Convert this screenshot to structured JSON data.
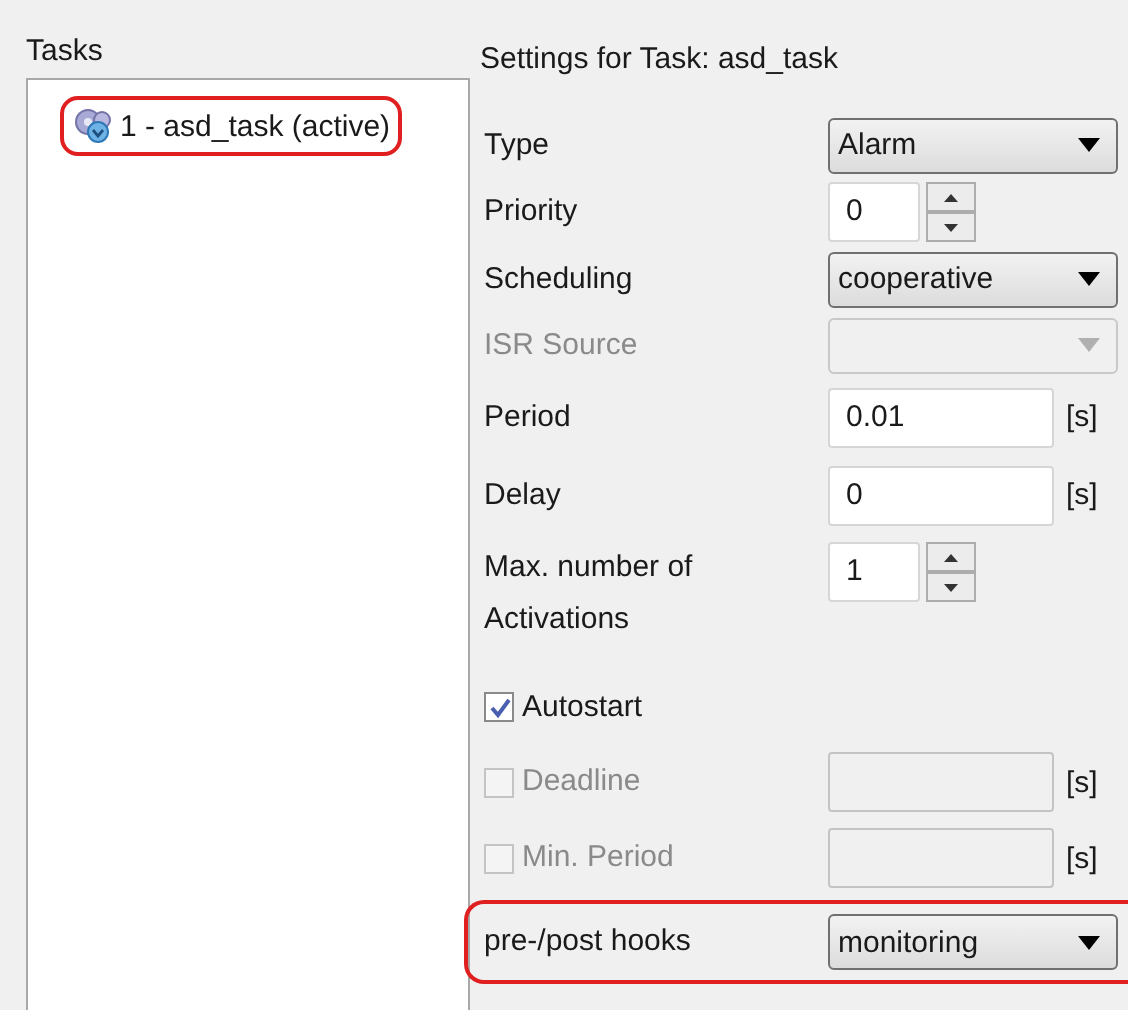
{
  "tasks_panel": {
    "title": "Tasks",
    "items": [
      {
        "label": "1 - asd_task (active)",
        "highlighted": true
      }
    ]
  },
  "settings": {
    "title": "Settings for Task: asd_task",
    "rows": [
      {
        "kind": "combo",
        "label": "Type",
        "value": "Alarm",
        "disabled": false,
        "highlighted": false
      },
      {
        "kind": "spin",
        "label": "Priority",
        "value": "0",
        "highlighted": false
      },
      {
        "kind": "combo",
        "label": "Scheduling",
        "value": "cooperative",
        "disabled": false,
        "highlighted": false
      },
      {
        "kind": "combo",
        "label": "ISR Source",
        "disabled": true,
        "highlighted": false
      },
      {
        "kind": "text",
        "label": "Period",
        "value": "0.01",
        "unit": "[s]",
        "disabled": false,
        "highlighted": false
      },
      {
        "kind": "text",
        "label": "Delay",
        "value": "0",
        "unit": "[s]",
        "disabled": false,
        "highlighted": false
      },
      {
        "kind": "spin",
        "label": "Max. number of Activations",
        "value": "1",
        "highlighted": false
      },
      {
        "kind": "check",
        "label": "Autostart",
        "checked": true,
        "disabled": false,
        "highlighted": false
      },
      {
        "kind": "check-text",
        "label": "Deadline",
        "checked": false,
        "disabled": true,
        "unit": "[s]",
        "highlighted": false
      },
      {
        "kind": "check-text",
        "label": "Min. Period",
        "checked": false,
        "disabled": true,
        "unit": "[s]",
        "highlighted": false
      },
      {
        "kind": "combo",
        "label": "pre-/post hooks",
        "value": "monitoring",
        "disabled": false,
        "highlighted": true
      }
    ]
  }
}
